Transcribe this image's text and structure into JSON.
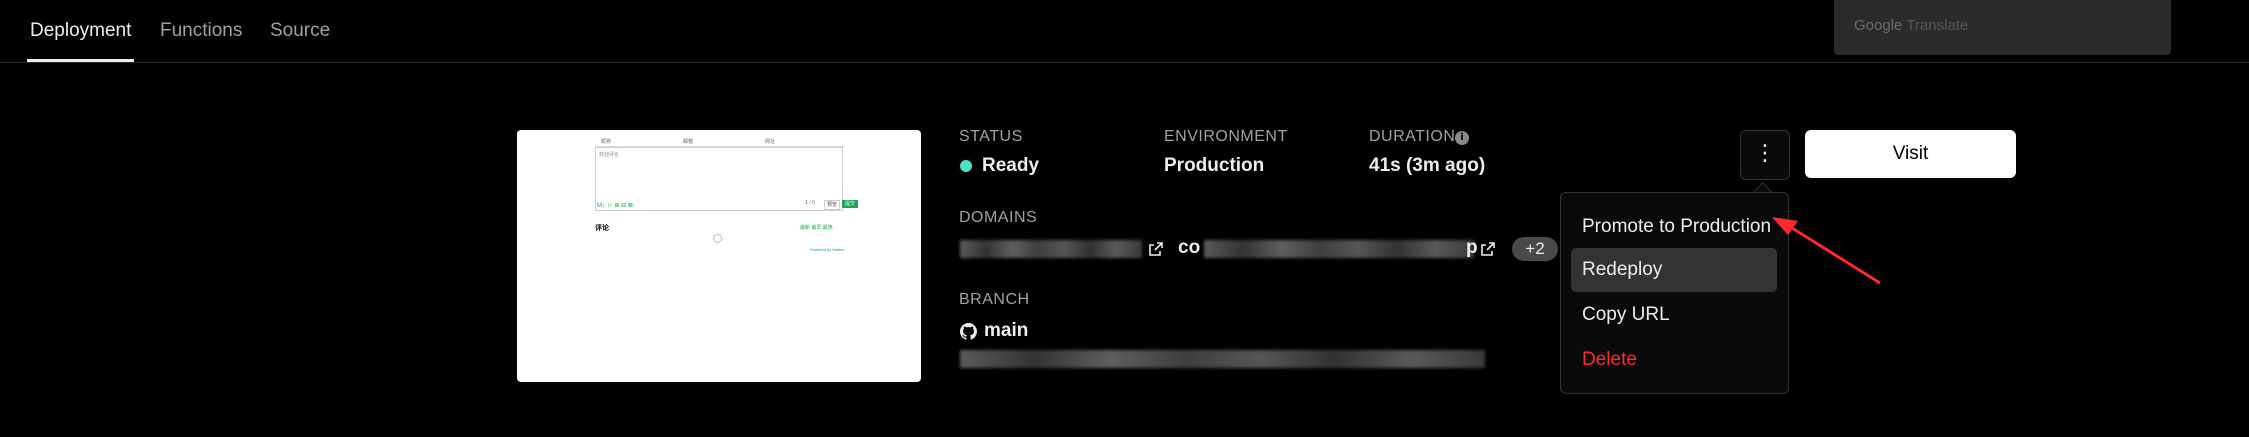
{
  "tabs": [
    {
      "label": "Deployment"
    },
    {
      "label": "Functions"
    },
    {
      "label": "Source"
    }
  ],
  "translate": {
    "logo_google": "Google",
    "logo_translate": "Translate"
  },
  "preview": {
    "head_cols": [
      "昵称",
      "邮箱",
      "网址"
    ],
    "placeholder": "欢迎评论",
    "tools": "M↓ ☺ ⊞ ⊟ ⊠",
    "btn_preview": "预览",
    "btn_submit": "提交",
    "comment_title": "评论",
    "links": "最新 最早 最热",
    "footer": "Powered by Waline"
  },
  "status": {
    "label": "Status",
    "value": "Ready",
    "color": "#50e3c2"
  },
  "environment": {
    "label": "Environment",
    "value": "Production"
  },
  "duration": {
    "label": "Duration",
    "value": "41s (3m ago)",
    "info_icon": "info-icon"
  },
  "domains": {
    "label": "Domains",
    "domain2_prefix": "co",
    "domain2_suffix": "p",
    "more_count": "+2"
  },
  "branch": {
    "label": "Branch",
    "value": "main"
  },
  "actions": {
    "kebab_icon": "⋮",
    "visit_label": "Visit"
  },
  "menu": {
    "items": [
      {
        "label": "Promote to Production"
      },
      {
        "label": "Redeploy"
      },
      {
        "label": "Copy URL"
      },
      {
        "label": "Delete"
      }
    ],
    "highlight_color": "#333333",
    "danger_color": "#ff2b2b"
  }
}
